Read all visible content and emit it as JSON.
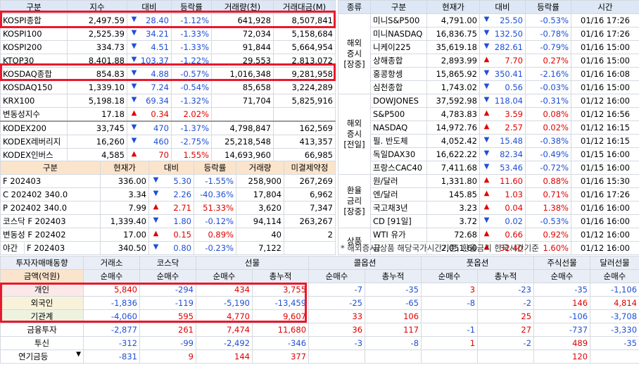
{
  "domestic": {
    "headers": [
      "구분",
      "지수",
      "대비",
      "등락률",
      "거래량(천)",
      "거래대금(M)"
    ],
    "rows": [
      {
        "name": "KOSPI종합",
        "value": "2,497.59",
        "dir": "dn",
        "change": "28.40",
        "rate": "-1.12%",
        "volume": "641,928",
        "amount": "8,507,841"
      },
      {
        "name": "KOSPI100",
        "value": "2,525.39",
        "dir": "dn",
        "change": "34.21",
        "rate": "-1.33%",
        "volume": "72,034",
        "amount": "5,158,684"
      },
      {
        "name": "KOSPI200",
        "value": "334.73",
        "dir": "dn",
        "change": "4.51",
        "rate": "-1.33%",
        "volume": "91,844",
        "amount": "5,664,954"
      },
      {
        "name": "KTOP30",
        "value": "8,401.88",
        "dir": "dn",
        "change": "103.37",
        "rate": "-1.22%",
        "volume": "29,553",
        "amount": "2,813,072"
      },
      {
        "name": "KOSDAQ종합",
        "value": "854.83",
        "dir": "dn",
        "change": "4.88",
        "rate": "-0.57%",
        "volume": "1,016,348",
        "amount": "9,281,958"
      },
      {
        "name": "KOSDAQ150",
        "value": "1,339.10",
        "dir": "dn",
        "change": "7.24",
        "rate": "-0.54%",
        "volume": "85,658",
        "amount": "3,224,289"
      },
      {
        "name": "KRX100",
        "value": "5,198.18",
        "dir": "dn",
        "change": "69.34",
        "rate": "-1.32%",
        "volume": "71,704",
        "amount": "5,825,916"
      },
      {
        "name": "변동성지수",
        "value": "17.18",
        "dir": "up",
        "change": "0.34",
        "rate": "2.02%",
        "volume": "",
        "amount": ""
      },
      {
        "name": "KODEX200",
        "value": "33,745",
        "dir": "dn",
        "change": "470",
        "rate": "-1.37%",
        "volume": "4,798,847",
        "amount": "162,569"
      },
      {
        "name": "KODEX레버리지",
        "value": "16,260",
        "dir": "dn",
        "change": "460",
        "rate": "-2.75%",
        "volume": "25,218,548",
        "amount": "413,357"
      },
      {
        "name": "KODEX인버스",
        "value": "4,585",
        "dir": "up",
        "change": "70",
        "rate": "1.55%",
        "volume": "14,693,960",
        "amount": "66,985"
      }
    ]
  },
  "futures": {
    "headers": [
      "구분",
      "현재가",
      "대비",
      "등락률",
      "거래량",
      "미결제약정"
    ],
    "rows": [
      {
        "name": "F 202403",
        "value": "336.00",
        "dir": "dn",
        "change": "5.30",
        "rate": "-1.55%",
        "volume": "258,900",
        "oi": "267,269"
      },
      {
        "name": "C 202402 340.0",
        "value": "3.34",
        "dir": "dn",
        "change": "2.26",
        "rate": "-40.36%",
        "volume": "17,804",
        "oi": "6,962"
      },
      {
        "name": "P 202402 340.0",
        "value": "7.99",
        "dir": "up",
        "change": "2.71",
        "rate": "51.33%",
        "volume": "3,620",
        "oi": "7,347"
      },
      {
        "name": "코스닥 F 202403",
        "value": "1,339.40",
        "dir": "dn",
        "change": "1.80",
        "rate": "-0.12%",
        "volume": "94,114",
        "oi": "263,267"
      },
      {
        "name": "변동성 F 202402",
        "value": "17.00",
        "dir": "up",
        "change": "0.15",
        "rate": "0.89%",
        "volume": "40",
        "oi": "2"
      },
      {
        "name": "F 202403",
        "prefix": "야간",
        "value": "340.50",
        "dir": "dn",
        "change": "0.80",
        "rate": "-0.23%",
        "volume": "7,122",
        "oi": ""
      }
    ]
  },
  "overseas": {
    "headers": [
      "종류",
      "구분",
      "현재가",
      "대비",
      "등락률",
      "시간"
    ],
    "groups": [
      {
        "label": "해외\n증시\n[장중]",
        "rows": [
          {
            "name": "미니S&P500",
            "value": "4,791.00",
            "dir": "dn",
            "change": "25.50",
            "rate": "-0.53%",
            "time": "01/16 17:26"
          },
          {
            "name": "미니NASDAQ",
            "value": "16,836.75",
            "dir": "dn",
            "change": "132.50",
            "rate": "-0.78%",
            "time": "01/16 17:26"
          },
          {
            "name": "니케이225",
            "value": "35,619.18",
            "dir": "dn",
            "change": "282.61",
            "rate": "-0.79%",
            "time": "01/16 15:00"
          },
          {
            "name": "상해종합",
            "value": "2,893.99",
            "dir": "up",
            "change": "7.70",
            "rate": "0.27%",
            "time": "01/16 15:00"
          },
          {
            "name": "홍콩항셍",
            "value": "15,865.92",
            "dir": "dn",
            "change": "350.41",
            "rate": "-2.16%",
            "time": "01/16 16:08"
          },
          {
            "name": "심천종합",
            "value": "1,743.02",
            "dir": "dn",
            "change": "0.56",
            "rate": "-0.03%",
            "time": "01/16 15:00"
          }
        ]
      },
      {
        "label": "해외\n증시\n[전일]",
        "rows": [
          {
            "name": "DOWJONES",
            "value": "37,592.98",
            "dir": "dn",
            "change": "118.04",
            "rate": "-0.31%",
            "time": "01/12 16:00"
          },
          {
            "name": "S&P500",
            "value": "4,783.83",
            "dir": "up",
            "change": "3.59",
            "rate": "0.08%",
            "time": "01/12 16:56"
          },
          {
            "name": "NASDAQ",
            "value": "14,972.76",
            "dir": "up",
            "change": "2.57",
            "rate": "0.02%",
            "time": "01/12 16:15"
          },
          {
            "name": "필. 반도체",
            "value": "4,052.42",
            "dir": "dn",
            "change": "15.48",
            "rate": "-0.38%",
            "time": "01/12 16:15"
          },
          {
            "name": "독일DAX30",
            "value": "16,622.22",
            "dir": "dn",
            "change": "82.34",
            "rate": "-0.49%",
            "time": "01/15 16:00"
          },
          {
            "name": "프랑스CAC40",
            "value": "7,411.68",
            "dir": "dn",
            "change": "53.46",
            "rate": "-0.72%",
            "time": "01/15 16:00"
          }
        ]
      },
      {
        "label": "환율\n금리\n[장중]",
        "rows": [
          {
            "name": "원/달러",
            "value": "1,331.80",
            "dir": "up",
            "change": "11.60",
            "rate": "0.88%",
            "time": "01/16 15:30"
          },
          {
            "name": "엔/달러",
            "value": "145.85",
            "dir": "up",
            "change": "1.03",
            "rate": "0.71%",
            "time": "01/16 17:26"
          },
          {
            "name": "국고채3년",
            "value": "3.23",
            "dir": "up",
            "change": "0.04",
            "rate": "1.38%",
            "time": "01/16 16:00"
          },
          {
            "name": "CD [91일]",
            "value": "3.72",
            "dir": "dn",
            "change": "0.02",
            "rate": "-0.53%",
            "time": "01/16 16:00"
          }
        ]
      },
      {
        "label": "상품",
        "rows": [
          {
            "name": "WTI 유가",
            "value": "72.68",
            "dir": "up",
            "change": "0.66",
            "rate": "0.92%",
            "time": "01/12 16:00"
          },
          {
            "name": "금",
            "value": "2,051.60",
            "dir": "up",
            "change": "32.40",
            "rate": "1.60%",
            "time": "01/12 16:00"
          }
        ]
      }
    ],
    "note": "* 해외증시/상품 해당국가시간기준, 환율금리 한국시간기준"
  },
  "investor": {
    "title": "투자자매매동향",
    "unit": "금액(억원)",
    "groups": [
      "거래소",
      "코스닥",
      "선물",
      "콜옵션",
      "풋옵션",
      "주식선물",
      "달러선물"
    ],
    "subheads": [
      "순매수",
      "순매수",
      "순매수",
      "총누적",
      "순매수",
      "총누적",
      "순매수",
      "총누적",
      "순매수",
      "순매수"
    ],
    "rows": [
      {
        "name": "개인",
        "style": "p",
        "vals": [
          "5,840",
          "-294",
          "434",
          "3,755",
          "-7",
          "-35",
          "3",
          "-23",
          "-35",
          "-1,106"
        ]
      },
      {
        "name": "외국인",
        "style": "y",
        "vals": [
          "-1,836",
          "-119",
          "-5,190",
          "-13,459",
          "-25",
          "-65",
          "-8",
          "-2",
          "146",
          "4,814"
        ]
      },
      {
        "name": "기관계",
        "style": "g",
        "vals": [
          "-4,060",
          "595",
          "4,770",
          "9,607",
          "33",
          "106",
          "",
          "25",
          "-106",
          "-3,708"
        ]
      },
      {
        "name": "금융투자",
        "style": "",
        "vals": [
          "-2,877",
          "261",
          "7,474",
          "11,680",
          "36",
          "117",
          "-1",
          "27",
          "-737",
          "-3,330"
        ]
      },
      {
        "name": "투신",
        "style": "",
        "vals": [
          "-312",
          "-99",
          "-2,492",
          "-346",
          "-3",
          "-8",
          "1",
          "-2",
          "489",
          "-35"
        ]
      },
      {
        "name": "연기금등",
        "style": "",
        "dropdown": "▼",
        "vals": [
          "-831",
          "9",
          "144",
          "377",
          "",
          "",
          "",
          "",
          "120",
          ""
        ]
      }
    ]
  },
  "icons": {
    "up": "▲",
    "dn": "▼"
  },
  "colors": {
    "up": "#e00000",
    "down": "#1e4fd6",
    "highlight": "#e8192c"
  }
}
